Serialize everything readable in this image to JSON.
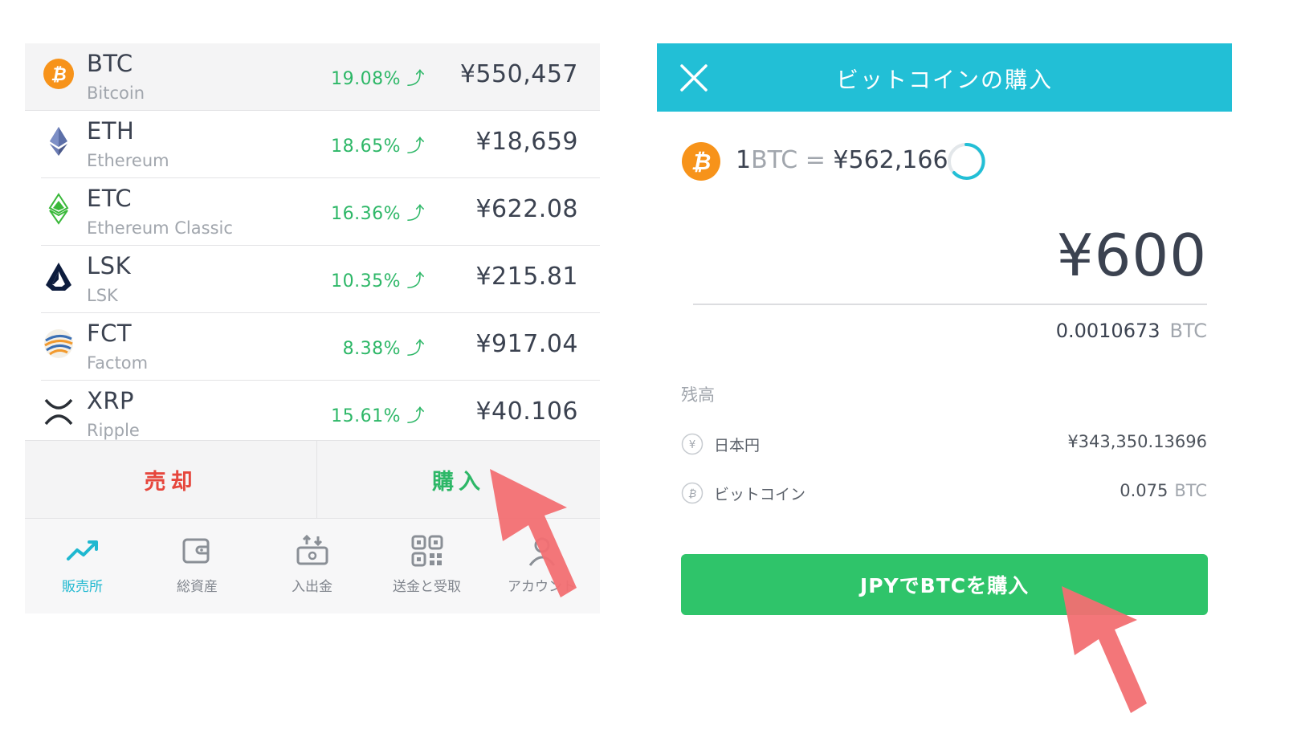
{
  "market": {
    "coins": [
      {
        "symbol": "BTC",
        "name": "Bitcoin",
        "change": "19.08%",
        "price": "¥550,457",
        "icon": "bitcoin-icon"
      },
      {
        "symbol": "ETH",
        "name": "Ethereum",
        "change": "18.65%",
        "price": "¥18,659",
        "icon": "ethereum-icon"
      },
      {
        "symbol": "ETC",
        "name": "Ethereum Classic",
        "change": "16.36%",
        "price": "¥622.08",
        "icon": "ethereum-classic-icon"
      },
      {
        "symbol": "LSK",
        "name": "LSK",
        "change": "10.35%",
        "price": "¥215.81",
        "icon": "lisk-icon"
      },
      {
        "symbol": "FCT",
        "name": "Factom",
        "change": "8.38%",
        "price": "¥917.04",
        "icon": "factom-icon"
      },
      {
        "symbol": "XRP",
        "name": "Ripple",
        "change": "15.61%",
        "price": "¥40.106",
        "icon": "ripple-icon"
      }
    ],
    "trend_glyph": "⤴",
    "sell_label": "売却",
    "buy_label": "購入"
  },
  "nav": {
    "items": [
      {
        "label": "販売所",
        "icon": "trend-chart-icon",
        "active": true
      },
      {
        "label": "総資産",
        "icon": "wallet-icon",
        "active": false
      },
      {
        "label": "入出金",
        "icon": "deposit-withdraw-icon",
        "active": false
      },
      {
        "label": "送金と受取",
        "icon": "qr-code-icon",
        "active": false
      },
      {
        "label": "アカウント",
        "icon": "account-icon",
        "active": false
      }
    ]
  },
  "purchase": {
    "title": "ビットコインの購入",
    "rate": {
      "qty": "1",
      "unit": "BTC",
      "eq": " = ",
      "price": "¥562,166"
    },
    "amount": "¥600",
    "btc_amount": "0.0010673",
    "btc_unit": "BTC",
    "balance_label": "残高",
    "balances": [
      {
        "name": "日本円",
        "value": "¥343,350.13696",
        "unit": "",
        "icon": "yen-circle-icon"
      },
      {
        "name": "ビットコイン",
        "value": "0.075",
        "unit": "BTC",
        "icon": "bitcoin-circle-icon"
      }
    ],
    "submit_label": "JPYでBTCを購入"
  },
  "colors": {
    "header": "#22bfd6",
    "positive": "#2db767",
    "sell": "#e6463c",
    "submit": "#2fc46a",
    "pointer": "#f26f72",
    "bitcoin": "#f7931a"
  }
}
